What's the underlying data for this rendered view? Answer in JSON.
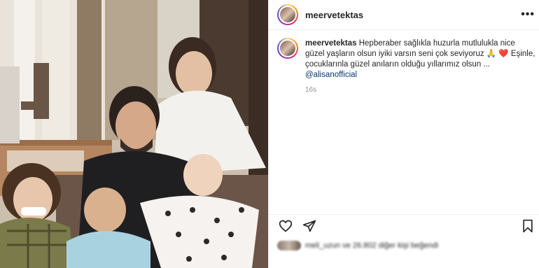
{
  "post": {
    "username": "meervetektas",
    "more_label": "•••"
  },
  "caption": {
    "username": "meervetektas",
    "text_part1": "Hepberaber sağlıkla huzurla mutlulukla nice güzel yaşların olsun iyiki varsın seni çok seviyoruz ",
    "emoji": "🙏 ❤️",
    "text_part2": " Eşinle, çocuklarınla güzel anıların olduğu yıllarımız olsun ",
    "mention": "@alisanofficial",
    "time": "16s"
  },
  "actions": {
    "like_icon": "heart-outline-icon",
    "share_icon": "paper-plane-icon",
    "save_icon": "bookmark-icon"
  },
  "likes": {
    "text": "meli_uzun ve 26.802 diğer kişi beğendi"
  },
  "colors": {
    "mention": "#00376b",
    "muted": "#8e8e8e",
    "border": "#efefef"
  }
}
